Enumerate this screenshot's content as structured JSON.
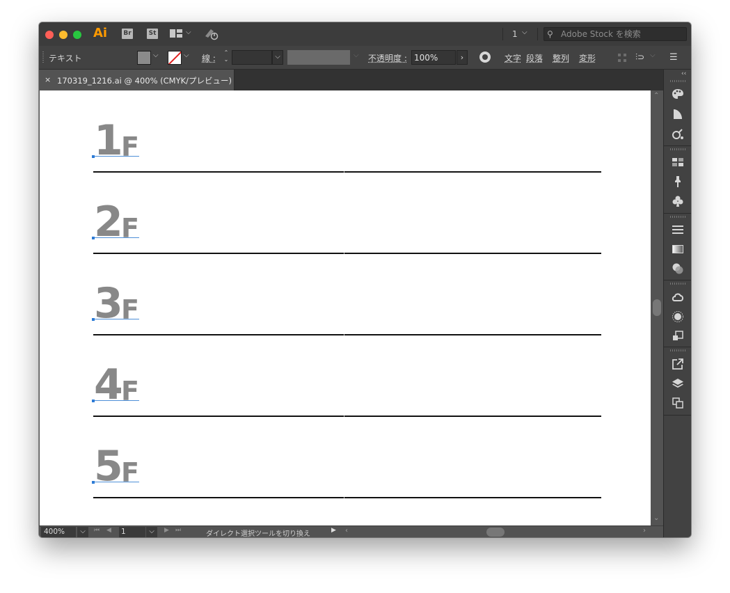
{
  "titlebar": {
    "app_logo": "Ai",
    "bridge_badge": "Br",
    "stock_badge": "St",
    "doc_count": "1",
    "stock_search_placeholder": "Adobe Stock を検索"
  },
  "controlbar": {
    "selection_type": "テキスト",
    "stroke_label": "線 :",
    "opacity_label": "不透明度 :",
    "opacity_value": "100%",
    "char_link": "文字",
    "para_link": "段落",
    "align_link": "整列",
    "transform_link": "変形"
  },
  "tab": {
    "close": "×",
    "label": "170319_1216.ai @ 400% (CMYK/プレビュー)"
  },
  "artboard": {
    "floors": [
      {
        "num": "1",
        "suffix": "F"
      },
      {
        "num": "2",
        "suffix": "F"
      },
      {
        "num": "3",
        "suffix": "F"
      },
      {
        "num": "4",
        "suffix": "F"
      },
      {
        "num": "5",
        "suffix": "F"
      }
    ],
    "text_color": "#888888"
  },
  "statusbar": {
    "zoom": "400%",
    "page": "1",
    "status_text": "ダイレクト選択ツールを切り換え"
  },
  "colors": {
    "accent_selection": "#2e7cd6",
    "stroke_none": "#e0201f",
    "app_orange": "#ff9a00"
  }
}
